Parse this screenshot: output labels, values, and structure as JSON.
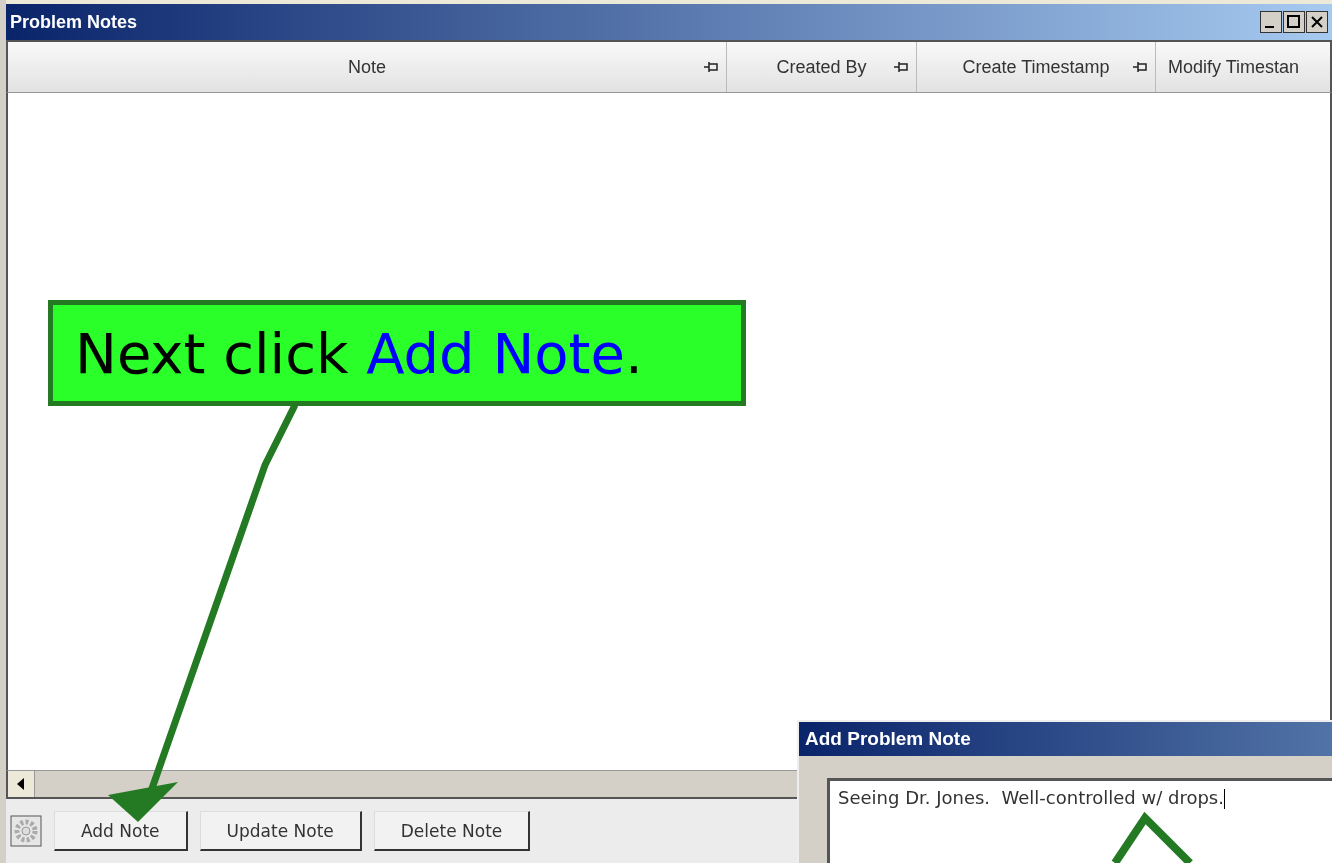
{
  "window": {
    "title": "Problem Notes"
  },
  "table": {
    "columns": [
      {
        "label": "Note"
      },
      {
        "label": "Created By"
      },
      {
        "label": "Create Timestamp"
      },
      {
        "label": "Modify Timestan"
      }
    ]
  },
  "buttons": [
    "Add Note",
    "Update Note",
    "Delete Note"
  ],
  "callout": {
    "parts": [
      {
        "kind": "plain",
        "text": "Next click "
      },
      {
        "kind": "highlight",
        "text": "Add Note"
      },
      {
        "kind": "plain",
        "text": "."
      }
    ]
  },
  "dialog": {
    "title": "Add Problem Note",
    "note_value": "Seeing Dr. Jones.  Well-controlled w/ drops."
  }
}
